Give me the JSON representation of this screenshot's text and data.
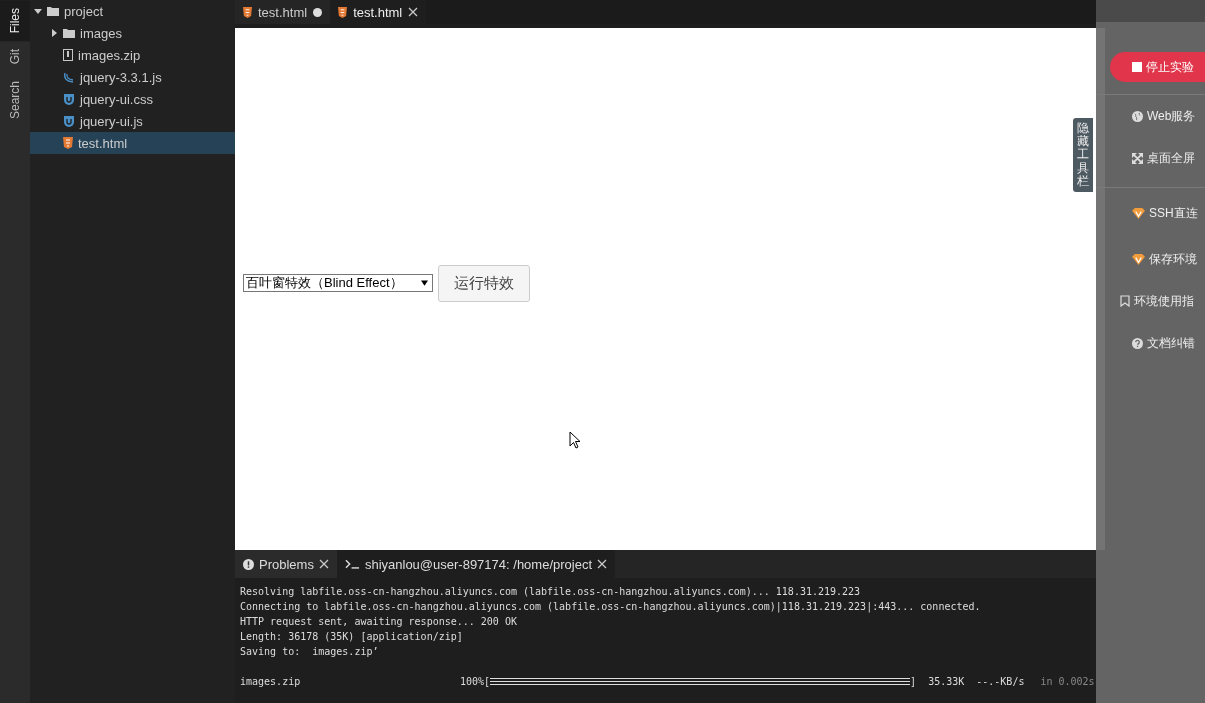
{
  "activity_bar": [
    {
      "label": "Files",
      "selected": true
    },
    {
      "label": "Git",
      "selected": false
    },
    {
      "label": "Search",
      "selected": false
    }
  ],
  "file_tree": {
    "root": {
      "label": "project",
      "expanded": true,
      "children": [
        {
          "label": "images",
          "kind": "folder",
          "expanded": false,
          "selected": false
        },
        {
          "label": "images.zip",
          "kind": "zip",
          "selected": false
        },
        {
          "label": "jquery-3.3.1.js",
          "kind": "jquery",
          "selected": false
        },
        {
          "label": "jquery-ui.css",
          "kind": "jqueryui",
          "selected": false
        },
        {
          "label": "jquery-ui.js",
          "kind": "jqueryui",
          "selected": false
        },
        {
          "label": "test.html",
          "kind": "html",
          "selected": true
        }
      ]
    }
  },
  "editor_tabs": [
    {
      "label": "test.html",
      "selected": false,
      "modified": true
    },
    {
      "label": "test.html",
      "selected": true,
      "modified": false
    }
  ],
  "preview": {
    "effect_select": {
      "value": "百叶窗特效（Blind Effect）"
    },
    "run_button": "运行特效"
  },
  "toolbar_toggle": "隐藏工具栏",
  "side_panel": {
    "stop_button": "停止实验",
    "items": [
      {
        "label": "Web服务",
        "kind": "globe",
        "group_start": false
      },
      {
        "label": "桌面全屏",
        "kind": "expand",
        "group_start": false
      },
      {
        "label": "SSH直连",
        "kind": "vip",
        "group_start": true
      },
      {
        "label": "保存环境",
        "kind": "vip",
        "group_start": false
      },
      {
        "label": "环境使用指",
        "kind": "bookmark",
        "group_start": false
      },
      {
        "label": "文档纠错",
        "kind": "help",
        "group_start": false
      }
    ]
  },
  "bottom_panel": {
    "tabs": [
      {
        "label": "Problems",
        "kind": "problems",
        "selected": false
      },
      {
        "label": "shiyanlou@user-897174: /home/project",
        "kind": "terminal",
        "selected": true
      }
    ],
    "terminal_lines": [
      "Resolving labfile.oss-cn-hangzhou.aliyuncs.com (labfile.oss-cn-hangzhou.aliyuncs.com)... 118.31.219.223",
      "Connecting to labfile.oss-cn-hangzhou.aliyuncs.com (labfile.oss-cn-hangzhou.aliyuncs.com)|118.31.219.223|:443... connected.",
      "HTTP request sent, awaiting response... 200 OK",
      "Length: 36178 (35K) [application/zip]",
      "Saving to:  images.zip’"
    ],
    "progress": {
      "file": "images.zip",
      "percent": "100%[",
      "end": "]",
      "level": 1.0,
      "size": "35.33K",
      "speed": "--.-KB/s",
      "time": "in 0.002s"
    }
  }
}
